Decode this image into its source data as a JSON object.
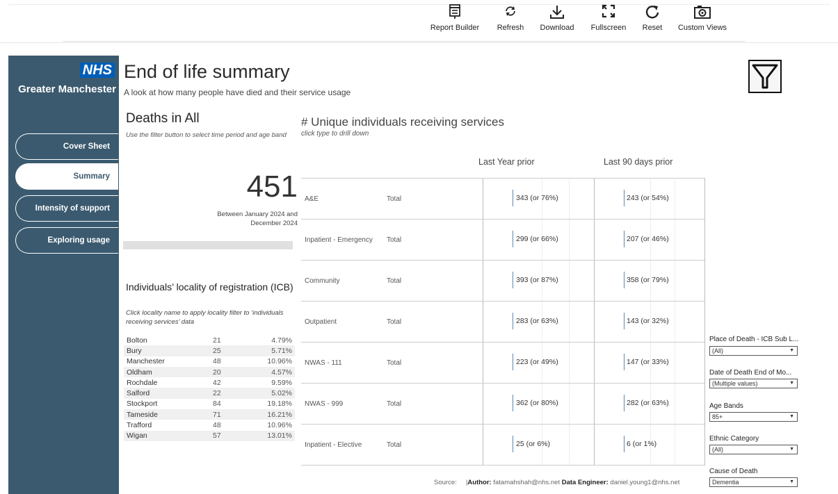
{
  "toolbar": {
    "items": [
      {
        "label": "Report Builder",
        "icon": "report-builder-icon"
      },
      {
        "label": "Refresh",
        "icon": "refresh-icon"
      },
      {
        "label": "Download",
        "icon": "download-icon"
      },
      {
        "label": "Fullscreen",
        "icon": "fullscreen-icon"
      },
      {
        "label": "Reset",
        "icon": "reset-icon"
      },
      {
        "label": "Custom Views",
        "icon": "camera-icon"
      }
    ]
  },
  "brand": {
    "logo": "NHS",
    "org": "Greater Manchester",
    "logo_color": "#005eb8",
    "sidebar_color": "#3b5a6f"
  },
  "nav": {
    "items": [
      {
        "label": "Cover Sheet",
        "active": false
      },
      {
        "label": "Summary",
        "active": true
      },
      {
        "label": "Intensity of support",
        "active": false
      },
      {
        "label": "Exploring usage",
        "active": false
      }
    ]
  },
  "header": {
    "title": "End of life summary",
    "subtitle": "A look at how many people have died and their service usage"
  },
  "deaths": {
    "title": "Deaths in All",
    "note": "Use the filter button to select time period and age band",
    "count": "451",
    "period_line1": "Between January 2024 and",
    "period_line2": "December 2024"
  },
  "locality": {
    "title": "Individuals’ locality of registration (ICB)",
    "note": "Click locality name to apply locality filter to ‘individuals receiving services’ data",
    "rows": [
      {
        "name": "Bolton",
        "count": "21",
        "pct": "4.79%"
      },
      {
        "name": "Bury",
        "count": "25",
        "pct": "5.71%"
      },
      {
        "name": "Manchester",
        "count": "48",
        "pct": "10.96%"
      },
      {
        "name": "Oldham",
        "count": "20",
        "pct": "4.57%"
      },
      {
        "name": "Rochdale",
        "count": "42",
        "pct": "9.59%"
      },
      {
        "name": "Salford",
        "count": "22",
        "pct": "5.02%"
      },
      {
        "name": "Stockport",
        "count": "84",
        "pct": "19.18%"
      },
      {
        "name": "Tameside",
        "count": "71",
        "pct": "16.21%"
      },
      {
        "name": "Trafford",
        "count": "48",
        "pct": "10.96%"
      },
      {
        "name": "Wigan",
        "count": "57",
        "pct": "13.01%"
      }
    ]
  },
  "services": {
    "title": "# Unique individuals receiving services",
    "note": "click type to drill down",
    "col1": "Last Year prior",
    "col2": "Last 90 days prior",
    "rows": [
      {
        "name": "A&E",
        "type": "Total",
        "year": "343 (or 76%)",
        "days90": "243 (or 54%)"
      },
      {
        "name": "Inpatient - Emergency",
        "type": "Total",
        "year": "299 (or 66%)",
        "days90": "207 (or 46%)"
      },
      {
        "name": "Community",
        "type": "Total",
        "year": "393 (or 87%)",
        "days90": "358 (or 79%)"
      },
      {
        "name": "Outpatient",
        "type": "Total",
        "year": "283 (or 63%)",
        "days90": "143 (or 32%)"
      },
      {
        "name": "NWAS - 111",
        "type": "Total",
        "year": "223 (or 49%)",
        "days90": "147 (or 33%)"
      },
      {
        "name": "NWAS - 999",
        "type": "Total",
        "year": "362 (or 80%)",
        "days90": "282 (or 63%)"
      },
      {
        "name": "Inpatient - Elective",
        "type": "Total",
        "year": "25 (or 6%)",
        "days90": "6 (or 1%)"
      }
    ]
  },
  "filters": [
    {
      "label": "Place of Death - ICB Sub L...",
      "value": "(All)"
    },
    {
      "label": "Date of Death End of Mo...",
      "value": "(Multiple values)"
    },
    {
      "label": "Age Bands",
      "value": "85+"
    },
    {
      "label": "Ethnic Category",
      "value": "(All)"
    },
    {
      "label": "Cause of Death",
      "value": "Dementia"
    }
  ],
  "footer": {
    "source": "Source:",
    "author_label": "Author:",
    "author": "fatamahshah@nhs.net",
    "engineer_label": "Data Engineer:",
    "engineer": "daniel.young1@nhs.net"
  }
}
